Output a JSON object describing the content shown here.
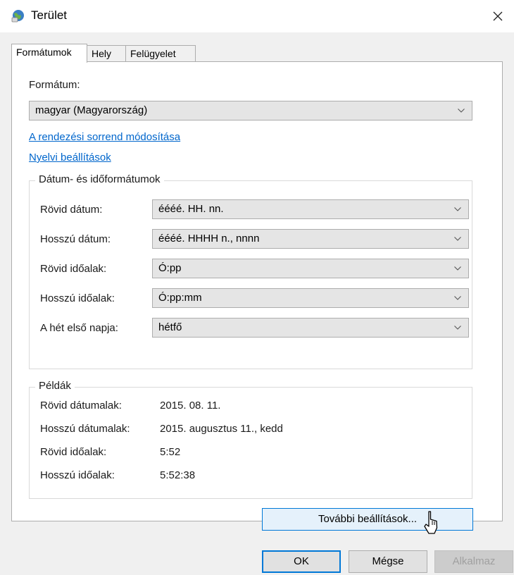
{
  "window": {
    "title": "Terület",
    "icon": "region-globe-icon",
    "close_icon": "close-icon"
  },
  "tabs": [
    {
      "label": "Formátumok",
      "active": true
    },
    {
      "label": "Hely",
      "active": false
    },
    {
      "label": "Felügyelet",
      "active": false
    }
  ],
  "format": {
    "label": "Formátum:",
    "value": "magyar (Magyarország)"
  },
  "links": {
    "sort_order": "A rendezési sorrend módosítása",
    "language_settings": "Nyelvi beállítások"
  },
  "date_time_group": {
    "title": "Dátum- és időformátumok",
    "rows": [
      {
        "label": "Rövid dátum:",
        "value": "éééé. HH. nn."
      },
      {
        "label": "Hosszú dátum:",
        "value": "éééé. HHHH n., nnnn"
      },
      {
        "label": "Rövid időalak:",
        "value": "Ó:pp"
      },
      {
        "label": "Hosszú időalak:",
        "value": "Ó:pp:mm"
      },
      {
        "label": "A hét első napja:",
        "value": "hétfő"
      }
    ]
  },
  "examples": {
    "title": "Példák",
    "rows": [
      {
        "label": "Rövid dátumalak:",
        "value": "2015. 08. 11."
      },
      {
        "label": "Hosszú dátumalak:",
        "value": "2015. augusztus 11., kedd"
      },
      {
        "label": "Rövid időalak:",
        "value": "5:52"
      },
      {
        "label": "Hosszú időalak:",
        "value": "5:52:38"
      }
    ]
  },
  "buttons": {
    "more_settings": "További beállítások...",
    "ok": "OK",
    "cancel": "Mégse",
    "apply": "Alkalmaz"
  },
  "colors": {
    "link": "#0066cc",
    "accent": "#0078d7"
  }
}
